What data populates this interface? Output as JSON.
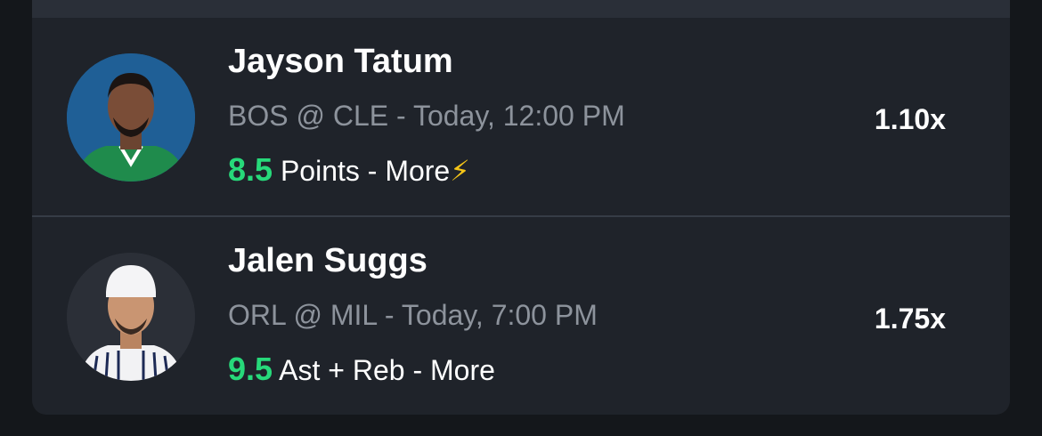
{
  "colors": {
    "line_value": "#27d97a",
    "boost_icon": "#f5c518",
    "card_bg": "#1f232a",
    "page_bg": "#14171b"
  },
  "picks": [
    {
      "player": "Jayson Tatum",
      "game": "BOS @ CLE - Today, 12:00 PM",
      "line": "8.5",
      "prop": "Points - More",
      "boost_icon": "⚡",
      "multiplier": "1.10x",
      "avatar_icon": "player-headshot-icon"
    },
    {
      "player": "Jalen Suggs",
      "game": "ORL @ MIL - Today, 7:00 PM",
      "line": "9.5",
      "prop": "Ast + Reb - More",
      "multiplier": "1.75x",
      "avatar_icon": "player-headshot-icon"
    }
  ]
}
